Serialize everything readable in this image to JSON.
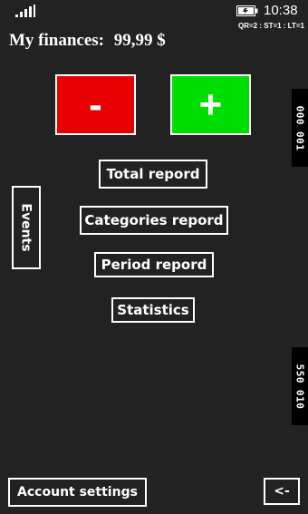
{
  "status_bar": {
    "signal_icon": "signal-bars-icon",
    "battery_icon": "battery-icon",
    "time": "10:38",
    "diagnostics": "QR=2 : ST=1 : LT=1"
  },
  "header": {
    "title": "My finances:",
    "balance": "99,99 $"
  },
  "actions": {
    "minus_label": "-",
    "plus_label": "+",
    "minus_color": "#e60000",
    "plus_color": "#00dd00"
  },
  "menu": {
    "total_report": "Total repord",
    "categories_report": "Categories repord",
    "period_report": "Period repord",
    "statistics": "Statistics",
    "events": "Events"
  },
  "side": {
    "top_badge": "000 001",
    "bottom_badge": "550 010"
  },
  "footer": {
    "account_settings": "Account settings",
    "back": "<-"
  }
}
